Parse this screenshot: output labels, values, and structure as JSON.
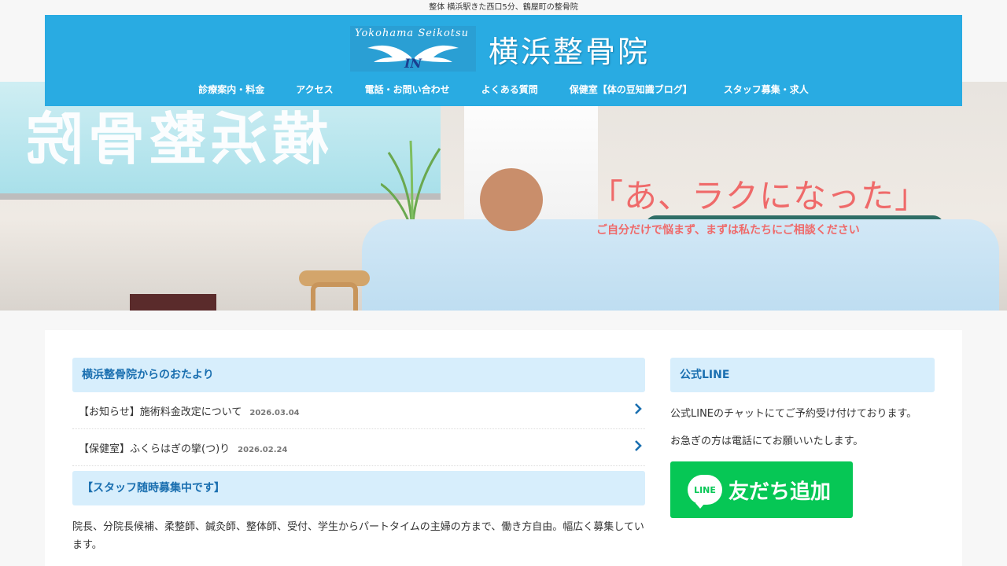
{
  "site": {
    "tagline": "整体 横浜駅きた西口5分、鶴屋町の整骨院",
    "logo_script": "Yokohama Seikotsu",
    "logo_mark": "IN",
    "logo_title": "横浜整骨院"
  },
  "nav": {
    "items": [
      {
        "label": "診療案内・料金"
      },
      {
        "label": "アクセス"
      },
      {
        "label": "電話・お問い合わせ"
      },
      {
        "label": "よくある質問"
      },
      {
        "label": "保健室【体の豆知識ブログ】"
      },
      {
        "label": "スタッフ募集・求人"
      }
    ]
  },
  "hero": {
    "window_text": "横浜整骨院",
    "headline": "「あ、ラクになった」",
    "subline": "ご自分だけで悩まず、まずは私たちにご相談ください"
  },
  "news": {
    "heading": "横浜整骨院からのおたより",
    "items": [
      {
        "title": "【お知らせ】施術料金改定について",
        "date": "2026.03.04"
      },
      {
        "title": "【保健室】ふくらはぎの攣(つ)り",
        "date": "2026.02.24"
      }
    ]
  },
  "recruit": {
    "heading": "【スタッフ随時募集中です】",
    "text": "院長、分院長候補、柔整師、鍼灸師、整体師、受付、学生からパートタイムの主婦の方まで、働き方自由。幅広く募集しています。"
  },
  "line": {
    "heading": "公式LINE",
    "text1": "公式LINEのチャットにてご予約受け付けております。",
    "text2": "お急ぎの方は電話にてお願いいたします。",
    "button_icon_text": "LINE",
    "button_label": "友だち追加",
    "brand_color": "#06c755"
  },
  "colors": {
    "header_bg": "#29abe2",
    "section_head_bg": "#d7eefc",
    "accent": "#1a6fb0",
    "hero_text": "#ef6a6a"
  }
}
